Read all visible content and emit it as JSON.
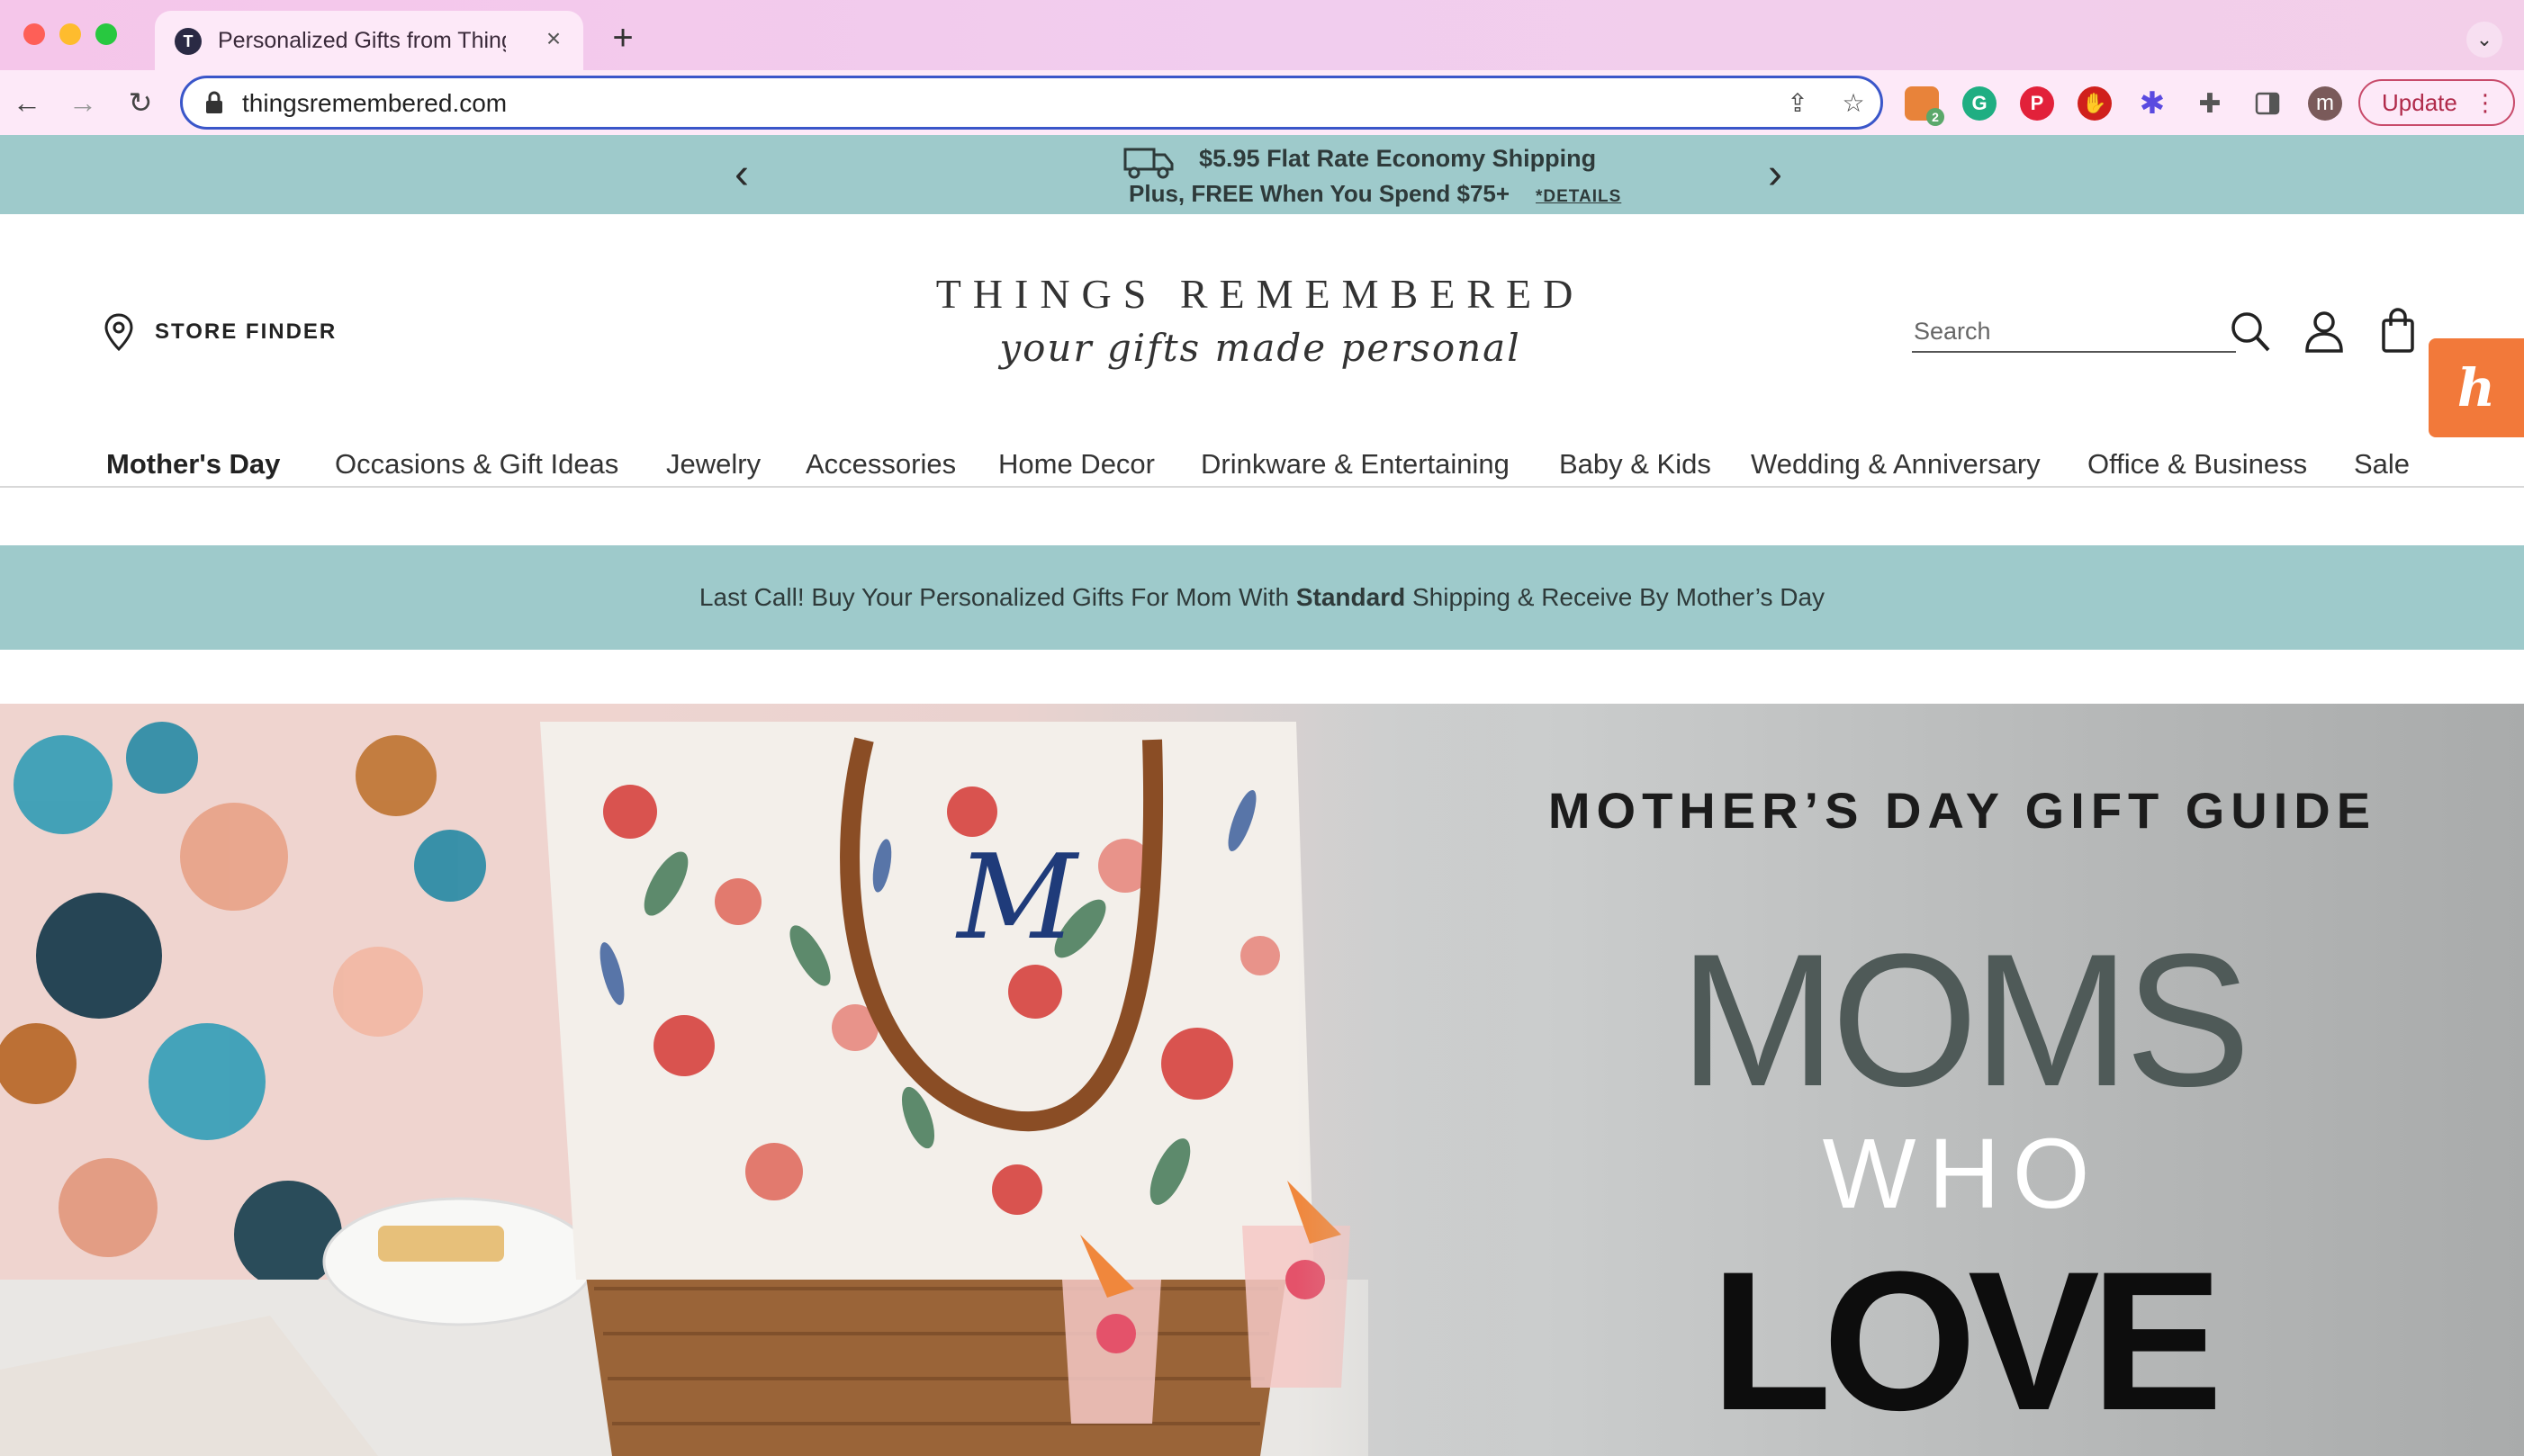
{
  "browser": {
    "tab_title": "Personalized Gifts from Things Remembered",
    "tab_favicon_letter": "T",
    "close_glyph": "×",
    "new_tab_glyph": "+",
    "url": "thingsremembered.com",
    "profile_initial": "m",
    "update_label": "Update",
    "extension_badge": "2"
  },
  "promo": {
    "line1": "$5.95 Flat Rate Economy Shipping",
    "line2": "Plus, FREE When You Spend $75+",
    "details_label": "*DETAILS"
  },
  "header": {
    "store_finder_label": "STORE FINDER",
    "brand_name": "THINGS REMEMBERED",
    "tagline": "your gifts made personal",
    "search_placeholder": "Search"
  },
  "nav": {
    "items": [
      {
        "label": "Mother's Day"
      },
      {
        "label": "Occasions & Gift Ideas"
      },
      {
        "label": "Jewelry"
      },
      {
        "label": "Accessories"
      },
      {
        "label": "Home Decor"
      },
      {
        "label": "Drinkware & Entertaining"
      },
      {
        "label": "Baby & Kids"
      },
      {
        "label": "Wedding & Anniversary"
      },
      {
        "label": "Office & Business"
      },
      {
        "label": "Sale"
      }
    ]
  },
  "announcement": {
    "before": "Last Call! Buy Your Personalized Gifts For Mom With ",
    "emphasis": "Standard",
    "after": " Shipping & Receive By Mother’s Day"
  },
  "hero": {
    "guide_title": "MOTHER’S DAY GIFT GUIDE",
    "line1": "MOMS",
    "line2": "WHO",
    "line3": "LOVE",
    "monogram": "M"
  },
  "colors": {
    "accent_teal": "#9ecacb",
    "honey_orange": "#f2793a",
    "omnibox_border": "#3a56c9"
  },
  "icons": [
    "back-icon",
    "forward-icon",
    "reload-icon",
    "lock-icon",
    "share-icon",
    "star-icon",
    "extensions-icon",
    "sidebar-icon",
    "truck-icon",
    "pin-icon",
    "search-icon",
    "account-icon",
    "bag-icon",
    "honey-icon"
  ]
}
